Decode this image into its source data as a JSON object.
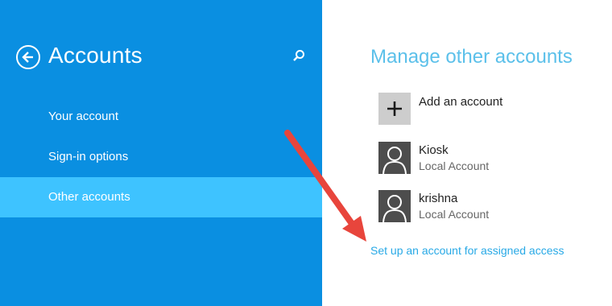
{
  "sidebar": {
    "title": "Accounts",
    "back_icon": "back-arrow-icon",
    "search_icon": "search-icon",
    "items": [
      {
        "label": "Your account",
        "selected": false
      },
      {
        "label": "Sign-in options",
        "selected": false
      },
      {
        "label": "Other accounts",
        "selected": true
      }
    ],
    "bg_color": "#0a8fe1",
    "selected_color": "#3ec3ff"
  },
  "main": {
    "title": "Manage other accounts",
    "add_account": {
      "label": "Add an account",
      "icon": "plus-icon"
    },
    "accounts": [
      {
        "name": "Kiosk",
        "type": "Local Account",
        "icon": "user-avatar-icon"
      },
      {
        "name": "krishna",
        "type": "Local Account",
        "icon": "user-avatar-icon"
      }
    ],
    "assigned_access_link": "Set up an account for assigned access",
    "accent_color": "#5bc0ea"
  },
  "annotation": {
    "icon": "red-arrow-icon",
    "color": "#e8453c"
  }
}
